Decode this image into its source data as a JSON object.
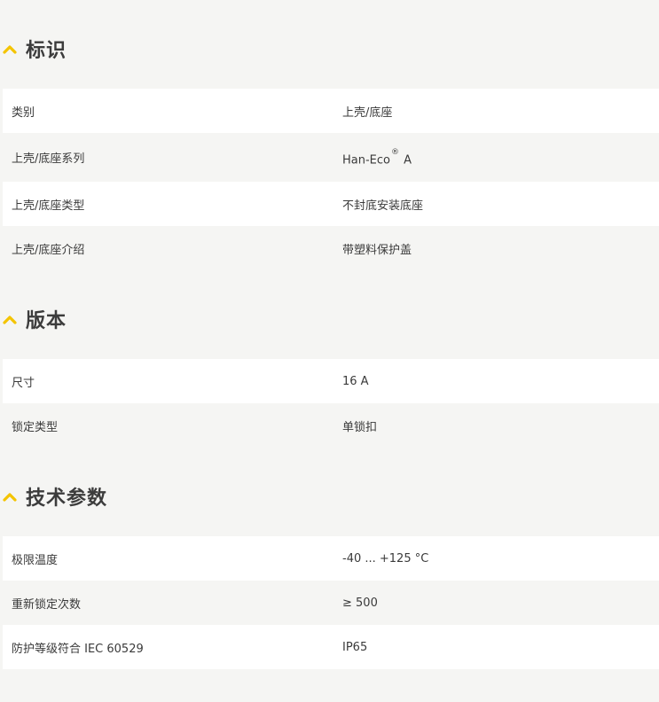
{
  "accent_color": "#f4c400",
  "sections": [
    {
      "title": "标识",
      "icon": "chevron-up-icon",
      "rows": [
        {
          "key": "类别",
          "value": "上壳/底座"
        },
        {
          "key": "上壳/底座系列",
          "value": "Han-Eco",
          "value_sup": "®",
          "value_suffix": " A"
        },
        {
          "key": "上壳/底座类型",
          "value": "不封底安装底座"
        },
        {
          "key": "上壳/底座介绍",
          "value": "带塑料保护盖"
        }
      ]
    },
    {
      "title": "版本",
      "icon": "chevron-up-icon",
      "rows": [
        {
          "key": "尺寸",
          "value": "16 A"
        },
        {
          "key": "锁定类型",
          "value": "单锁扣"
        }
      ]
    },
    {
      "title": "技术参数",
      "icon": "chevron-up-icon",
      "rows": [
        {
          "key": "极限温度",
          "value": "-40 ... +125 °C"
        },
        {
          "key": "重新锁定次数",
          "value": "≥ 500"
        },
        {
          "key": "防护等级符合 IEC 60529",
          "value": "IP65"
        }
      ]
    }
  ]
}
